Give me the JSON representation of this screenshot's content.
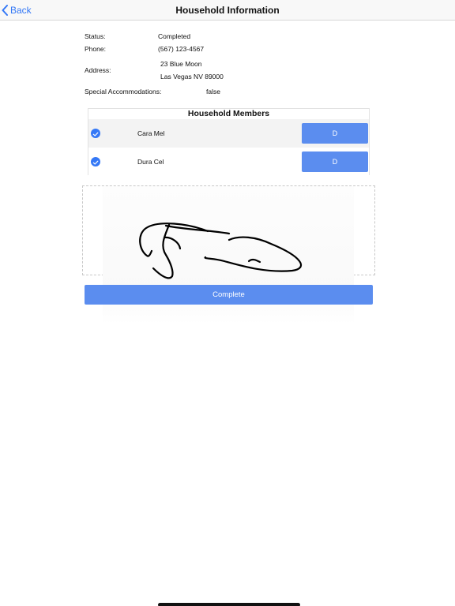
{
  "navbar": {
    "back_label": "Back",
    "title": "Household Information"
  },
  "info": {
    "status_label": "Status:",
    "status_value": "Completed",
    "phone_label": "Phone:",
    "phone_value": "(567) 123-4567",
    "address_label": "Address:",
    "address_line1": "23 Blue Moon",
    "address_line2": "Las Vegas NV 89000",
    "special_label": "Special Accommodations:",
    "special_value": "false"
  },
  "members": {
    "title": "Household Members",
    "rows": [
      {
        "name": "Cara Mel",
        "checked": true,
        "button_label": "D"
      },
      {
        "name": "Dura Cel",
        "checked": true,
        "button_label": "D"
      }
    ]
  },
  "actions": {
    "complete_label": "Complete"
  },
  "colors": {
    "accent": "#3478f6",
    "button": "#5b8def"
  }
}
